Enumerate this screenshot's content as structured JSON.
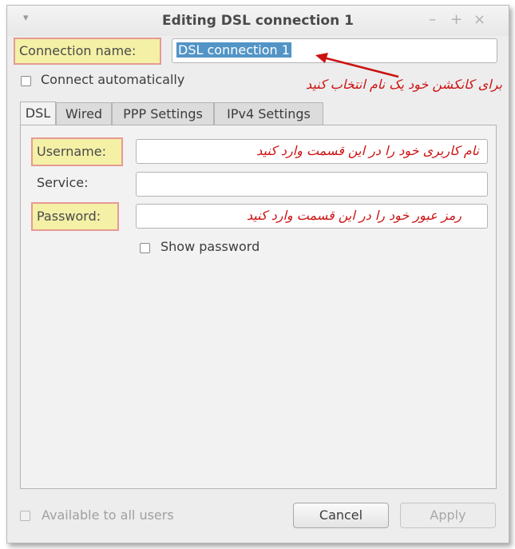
{
  "window": {
    "title": "Editing DSL connection 1",
    "controls": {
      "minimize": "–",
      "maximize": "+",
      "close": "×"
    }
  },
  "connection": {
    "name_label": "Connection name:",
    "name_value": "DSL connection 1",
    "name_annotation": "برای کانکشن خود یک نام انتخاب کنید",
    "connect_auto_label": "Connect automatically",
    "connect_auto_checked": false
  },
  "tabs": [
    {
      "label": "DSL",
      "active": true
    },
    {
      "label": "Wired",
      "active": false
    },
    {
      "label": "PPP Settings",
      "active": false
    },
    {
      "label": "IPv4 Settings",
      "active": false
    }
  ],
  "dsl": {
    "username_label": "Username:",
    "username_annotation": "نام کاربری خود را در این قسمت وارد کنید",
    "service_label": "Service:",
    "password_label": "Password:",
    "password_annotation": "رمز عبور خود را در این قسمت وارد کنید",
    "show_password_label": "Show password",
    "show_password_checked": false
  },
  "footer": {
    "available_label": "Available to all users",
    "available_checked": false,
    "cancel_label": "Cancel",
    "apply_label": "Apply"
  },
  "colors": {
    "highlight_fill": "#f4f0a6",
    "highlight_border": "#e59a93",
    "annotation_text": "#cc1111",
    "selection": "#5294c6"
  }
}
